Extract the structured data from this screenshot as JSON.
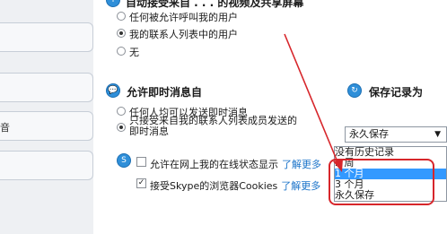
{
  "sidebar": {
    "partial_label": "音"
  },
  "video_section": {
    "heading": "自动接受来自 . . . 的视频及共享屏幕",
    "options": [
      "任何被允许呼叫我的用户",
      "我的联系人列表中的用户",
      "无"
    ],
    "selected": 1
  },
  "im_section": {
    "heading": "允许即时消息自",
    "options": [
      "任何人均可以发送即时消息",
      "只接受来自我的联系人列表成员发送的\n即时消息"
    ],
    "selected": 1
  },
  "history_section": {
    "heading": "保存记录为",
    "selected_value": "永久保存",
    "dropdown_options": [
      "没有历史记录",
      "2 周",
      "1 个月",
      "3 个月",
      "永久保存"
    ],
    "highlighted_index": 2
  },
  "online_status": {
    "label": "允许在网上我的在线状态显示",
    "link": "了解更多",
    "checked": false
  },
  "cookies": {
    "label": "接受Skype的浏览器Cookies",
    "link": "了解更多",
    "checked": true
  },
  "colors": {
    "accent": "#2f8fd9",
    "annotation": "#d7262b",
    "selection": "#3399ff"
  }
}
